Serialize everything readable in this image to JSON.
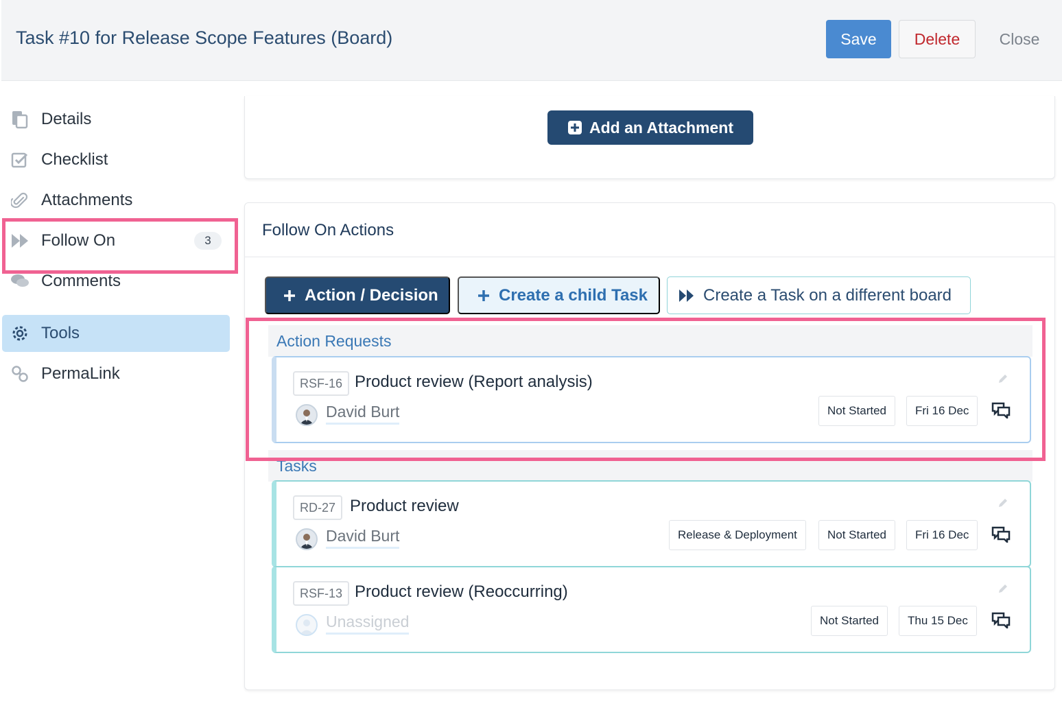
{
  "header": {
    "title": "Task #10 for Release Scope Features (Board)",
    "save_label": "Save",
    "delete_label": "Delete",
    "close_label": "Close"
  },
  "sidebar": {
    "items": [
      {
        "label": "Details",
        "icon": "document-icon"
      },
      {
        "label": "Checklist",
        "icon": "checkbox-icon"
      },
      {
        "label": "Attachments",
        "icon": "paperclip-icon"
      },
      {
        "label": "Follow On",
        "icon": "fast-forward-icon",
        "badge": "3"
      },
      {
        "label": "Comments",
        "icon": "chat-bubbles-icon"
      },
      {
        "label": "Tools",
        "icon": "gear-icon",
        "active": true
      },
      {
        "label": "PermaLink",
        "icon": "link-icon"
      }
    ]
  },
  "attachments": {
    "add_label": "Add an Attachment"
  },
  "follow_on": {
    "title": "Follow On Actions",
    "tabs": {
      "action_label": "Action / Decision",
      "child_label": "Create a child Task",
      "board_label": "Create a Task on a different board"
    },
    "sections": [
      {
        "heading": "Action Requests",
        "items": [
          {
            "id": "RSF-16",
            "title": "Product review (Report analysis)",
            "assignee": "David Burt",
            "tags": [],
            "status": "Not Started",
            "date": "Fri 16 Dec"
          }
        ]
      },
      {
        "heading": "Tasks",
        "items": [
          {
            "id": "RD-27",
            "title": "Product review",
            "assignee": "David Burt",
            "tags": [
              "Release & Deployment"
            ],
            "status": "Not Started",
            "date": "Fri 16 Dec"
          },
          {
            "id": "RSF-13",
            "title": "Product review (Reoccurring)",
            "assignee": "Unassigned",
            "tags": [],
            "status": "Not Started",
            "date": "Thu 15 Dec"
          }
        ]
      }
    ]
  },
  "colors": {
    "primary_dark": "#254a72",
    "save_blue": "#4a8ad1",
    "delete_red": "#c0272d",
    "highlight_pink": "#f06292",
    "active_nav": "#c6e2f7",
    "section_link": "#3a78b5"
  }
}
